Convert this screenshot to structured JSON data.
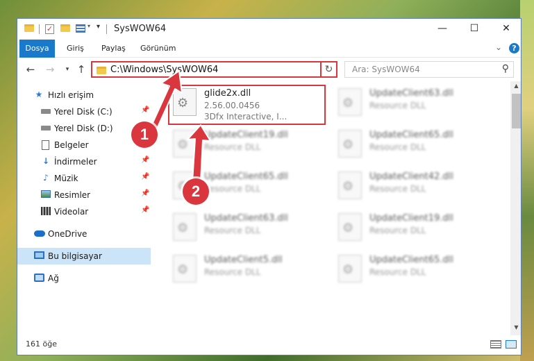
{
  "window": {
    "title": "SysWOW64",
    "buttons": {
      "minimize": "—",
      "maximize": "☐",
      "close": "✕"
    }
  },
  "ribbon": {
    "tabs": [
      "Dosya",
      "Giriş",
      "Paylaş",
      "Görünüm"
    ]
  },
  "address_bar": {
    "path": "C:\\Windows\\SysWOW64",
    "search_placeholder": "Ara: SysWOW64"
  },
  "sidebar": {
    "items": [
      {
        "label": "Hızlı erişim",
        "icon": "star-icon"
      },
      {
        "label": "Yerel Disk (C:)",
        "icon": "drive-icon",
        "pinned": true
      },
      {
        "label": "Yerel Disk (D:)",
        "icon": "drive-icon",
        "pinned": true
      },
      {
        "label": "Belgeler",
        "icon": "document-icon",
        "pinned": true
      },
      {
        "label": "İndirmeler",
        "icon": "download-icon",
        "pinned": true
      },
      {
        "label": "Müzik",
        "icon": "music-icon",
        "pinned": true
      },
      {
        "label": "Resimler",
        "icon": "pictures-icon",
        "pinned": true
      },
      {
        "label": "Videolar",
        "icon": "video-icon",
        "pinned": true
      },
      {
        "label": "OneDrive",
        "icon": "cloud-icon"
      },
      {
        "label": "Bu bilgisayar",
        "icon": "computer-icon",
        "selected": true
      },
      {
        "label": "Ağ",
        "icon": "network-icon"
      }
    ]
  },
  "files": [
    {
      "name": "glide2x.dll",
      "line2": "2.56.00.0456",
      "line3": "3Dfx Interactive, I...",
      "blurred": false
    },
    {
      "name": "UpdateClient63.dll",
      "line2": "Resource DLL",
      "blurred": true
    },
    {
      "name": "UpdateClient19.dll",
      "line2": "Resource DLL",
      "blurred": true
    },
    {
      "name": "UpdateClient65.dll",
      "line2": "Resource DLL",
      "blurred": true
    },
    {
      "name": "UpdateClient65.dll",
      "line2": "Resource DLL",
      "blurred": true
    },
    {
      "name": "UpdateClient42.dll",
      "line2": "Resource DLL",
      "blurred": true
    },
    {
      "name": "UpdateClient63.dll",
      "line2": "Resource DLL",
      "blurred": true
    },
    {
      "name": "UpdateClient19.dll",
      "line2": "Resource DLL",
      "blurred": true
    },
    {
      "name": "UpdateClient5.dll",
      "line2": "Resource DLL",
      "blurred": true
    },
    {
      "name": "UpdateClient65.dll",
      "line2": "Resource DLL",
      "blurred": true
    }
  ],
  "status": {
    "count": "161 öğe"
  },
  "callouts": {
    "one": "1",
    "two": "2"
  },
  "colors": {
    "accent": "#1979ca",
    "highlight": "#d9363e",
    "selection": "#cce4f7"
  }
}
